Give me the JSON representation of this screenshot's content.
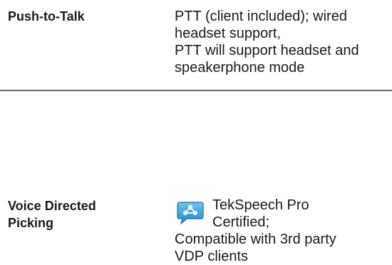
{
  "rows": [
    {
      "label": "Push-to-Talk",
      "value_lines": [
        "PTT (client included); wired",
        "headset support,",
        "PTT will support headset and",
        "speakerphone mode"
      ]
    },
    {
      "label_lines": [
        "Voice Directed",
        "Picking"
      ],
      "icon": "speech-bubble-network-icon",
      "cert_lines": [
        "TekSpeech Pro",
        "Certified;"
      ],
      "compat_lines": [
        "Compatible with 3rd party",
        "VDP clients"
      ]
    }
  ],
  "colors": {
    "text": "#1a1a1a",
    "divider": "#6d6d6d",
    "icon_blue": "#1f86c8",
    "icon_light": "#6ec4ee"
  }
}
